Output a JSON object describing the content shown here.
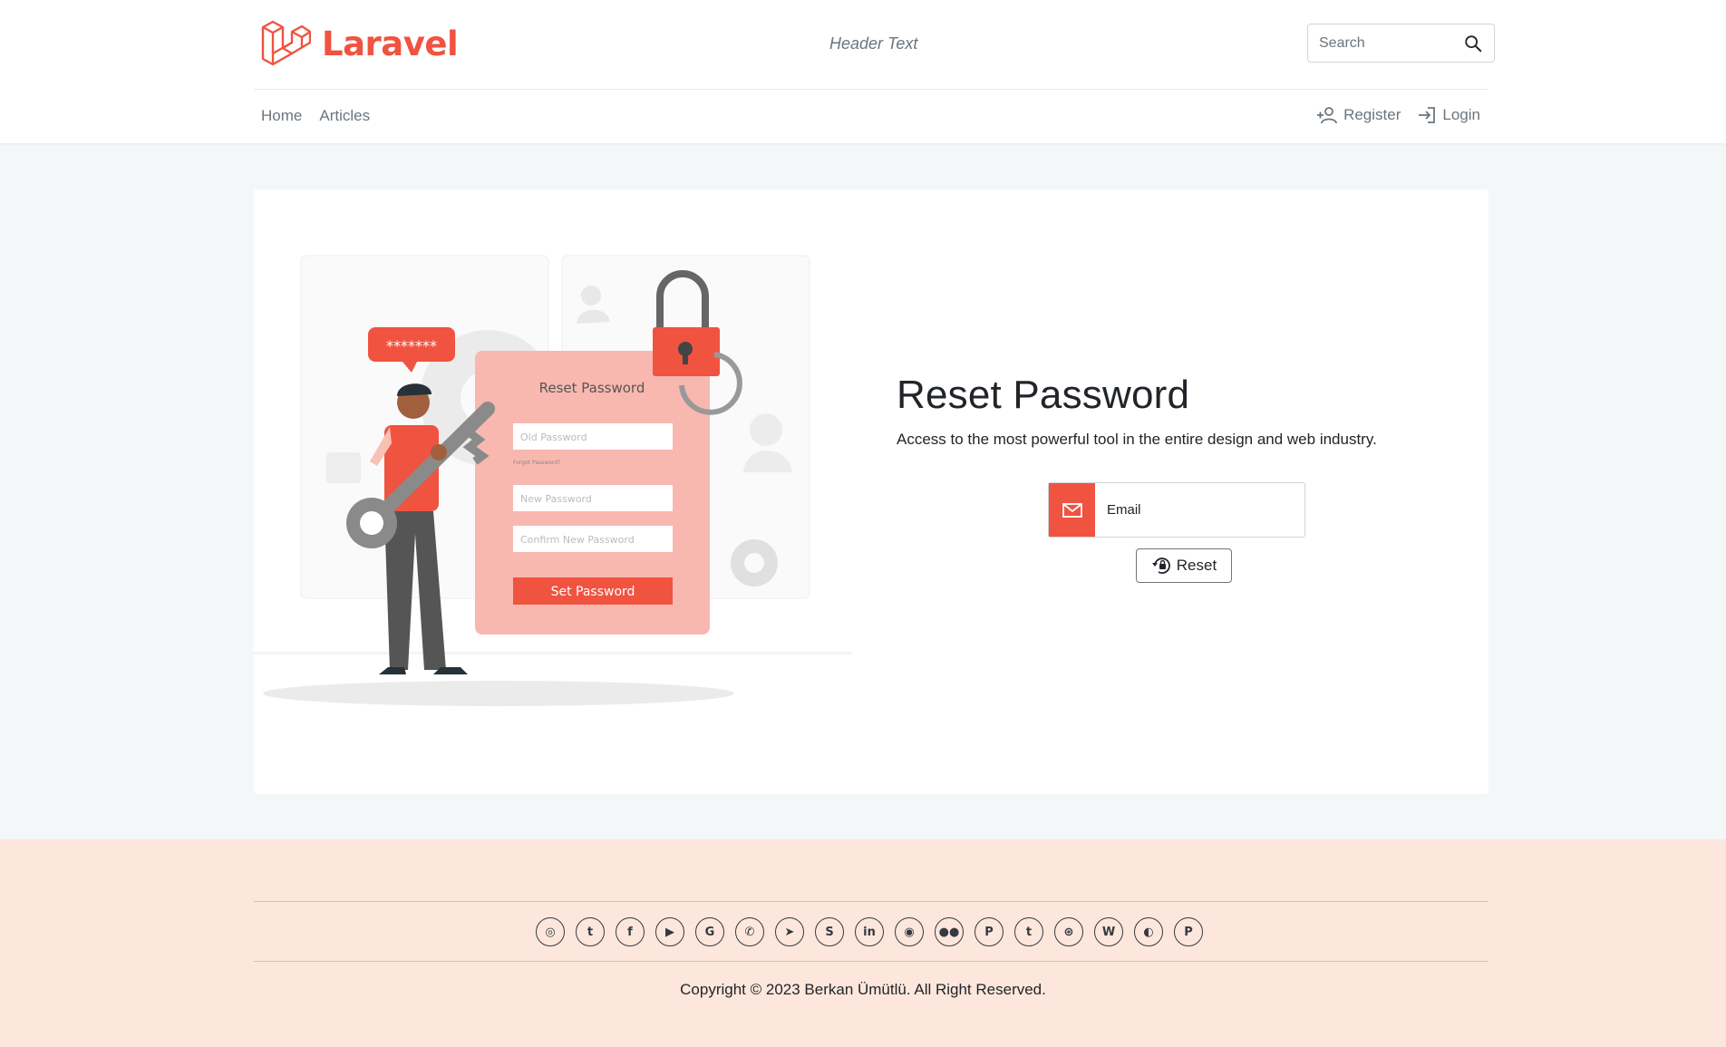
{
  "brand": {
    "name": "Laravel",
    "color": "#f05340"
  },
  "header": {
    "text": "Header Text"
  },
  "search": {
    "placeholder": "Search",
    "icon": "search-icon"
  },
  "nav": {
    "left": [
      {
        "label": "Home"
      },
      {
        "label": "Articles"
      }
    ],
    "right": [
      {
        "label": "Register",
        "icon": "person-plus-icon"
      },
      {
        "label": "Login",
        "icon": "login-icon"
      }
    ]
  },
  "illustration": {
    "bubble_text": "*******",
    "form_title": "Reset Password",
    "old_password": "Old Password",
    "forgot": "Forgot Password?",
    "new_password": "New Password",
    "confirm_password": "Confirm New Password",
    "button": "Set Password"
  },
  "main": {
    "title": "Reset Password",
    "subtitle": "Access to the most powerful tool in the entire design and web industry.",
    "email_placeholder": "Email",
    "reset_label": "Reset"
  },
  "footer": {
    "socials": [
      {
        "name": "instagram",
        "glyph": "◎"
      },
      {
        "name": "twitter",
        "glyph": "t"
      },
      {
        "name": "facebook",
        "glyph": "f"
      },
      {
        "name": "youtube",
        "glyph": "▶"
      },
      {
        "name": "google",
        "glyph": "G"
      },
      {
        "name": "whatsapp",
        "glyph": "✆"
      },
      {
        "name": "telegram",
        "glyph": "➤"
      },
      {
        "name": "skype",
        "glyph": "S"
      },
      {
        "name": "linkedin",
        "glyph": "in"
      },
      {
        "name": "github",
        "glyph": "◉"
      },
      {
        "name": "medium",
        "glyph": "●●"
      },
      {
        "name": "pinterest",
        "glyph": "P"
      },
      {
        "name": "tumblr",
        "glyph": "t"
      },
      {
        "name": "dribbble",
        "glyph": "⊛"
      },
      {
        "name": "wordpress",
        "glyph": "W"
      },
      {
        "name": "discord",
        "glyph": "◐"
      },
      {
        "name": "paypal",
        "glyph": "P"
      }
    ],
    "copyright": "Copyright © 2023 Berkan Ümütlü. All Right Reserved."
  },
  "colors": {
    "accent": "#f05340",
    "footer_bg": "#fde7dc",
    "page_bg": "#f4f7f8"
  }
}
